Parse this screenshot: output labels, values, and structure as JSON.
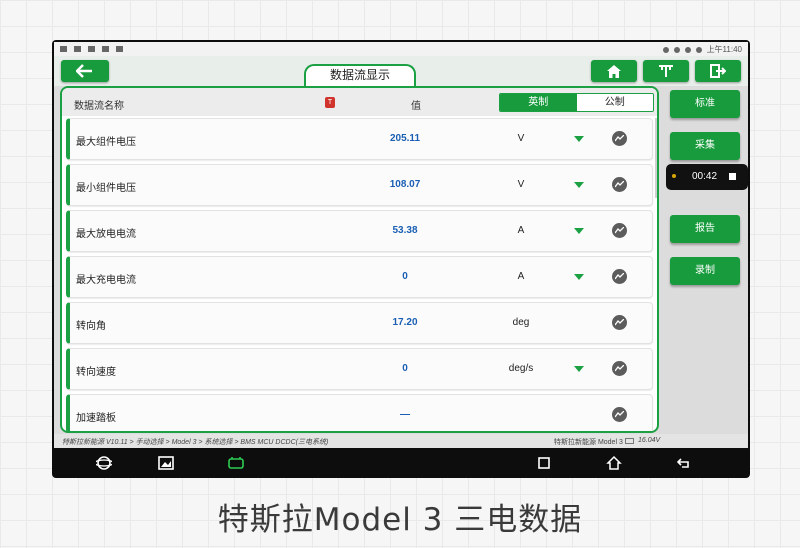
{
  "status_bar": {
    "time": "上午11:40"
  },
  "header": {
    "title": "数据流显示"
  },
  "table": {
    "col_name": "数据流名称",
    "col_value": "值",
    "unit_toggle": {
      "imperial": "英制",
      "metric": "公制"
    },
    "rows": [
      {
        "name": "最大组件电压",
        "value": "205.11",
        "unit": "V",
        "has_unit_dropdown": true
      },
      {
        "name": "最小组件电压",
        "value": "108.07",
        "unit": "V",
        "has_unit_dropdown": true
      },
      {
        "name": "最大放电电流",
        "value": "53.38",
        "unit": "A",
        "has_unit_dropdown": true
      },
      {
        "name": "最大充电电流",
        "value": "0",
        "unit": "A",
        "has_unit_dropdown": true
      },
      {
        "name": "转向角",
        "value": "17.20",
        "unit": "deg",
        "has_unit_dropdown": false
      },
      {
        "name": "转向速度",
        "value": "0",
        "unit": "deg/s",
        "has_unit_dropdown": true
      },
      {
        "name": "加速踏板",
        "value": "—",
        "unit": "",
        "has_unit_dropdown": false
      }
    ]
  },
  "side_buttons": {
    "standard": "标准",
    "capture": "采集",
    "report": "报告",
    "record": "录制"
  },
  "breadcrumb": "特斯拉新能源 V10.11 > 手动选择 > Model 3 > 系统选择 > BMS MCU DCDC(三电系统)",
  "vehicle_info": "特斯拉新能源 Model 3",
  "voltage": "16.04V",
  "recording_timer": "00:42",
  "caption": "特斯拉Model 3 三电数据",
  "colors": {
    "accent": "#179b3c",
    "value_text": "#1a5fb4",
    "flag": "#d0342c"
  }
}
